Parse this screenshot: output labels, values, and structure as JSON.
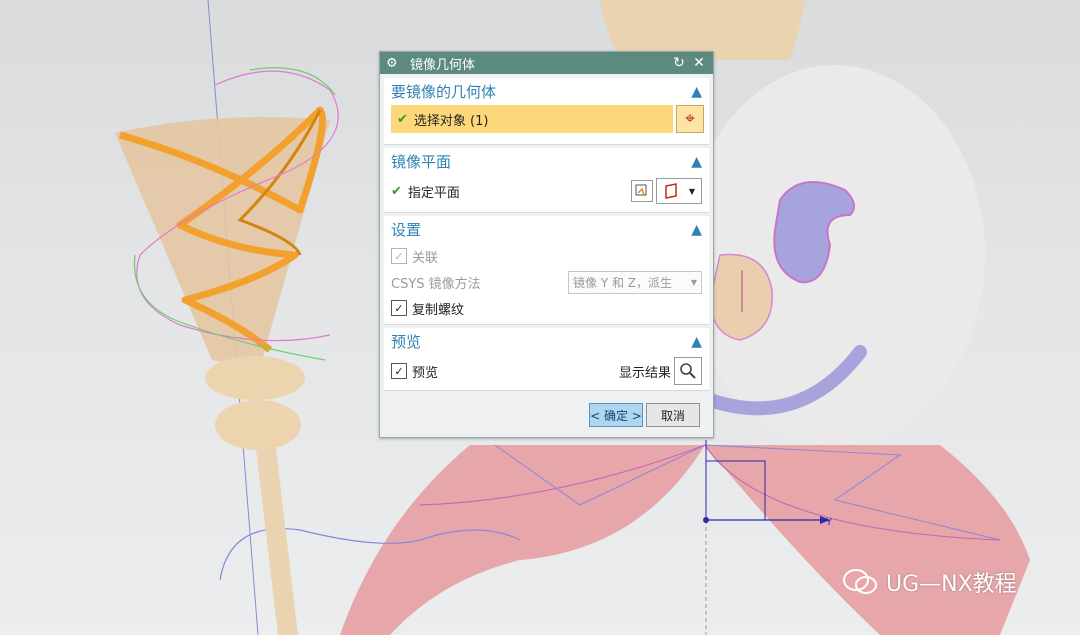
{
  "dialog": {
    "title": "镜像几何体",
    "icons": {
      "settings": "gear-icon",
      "reset": "reset-icon",
      "close": "close-icon"
    }
  },
  "groups": {
    "geometry": {
      "title": "要镜像的几何体",
      "select_label": "选择对象 (1)",
      "select_icon": "crosshair-icon"
    },
    "plane": {
      "title": "镜像平面",
      "specify_label": "指定平面"
    },
    "settings": {
      "title": "设置",
      "associative_label": "关联",
      "associative_checked": true,
      "associative_disabled": true,
      "csys_label": "CSYS 镜像方法",
      "csys_value": "镜像 Y 和 Z，派生",
      "copy_threads_label": "复制螺纹",
      "copy_threads_checked": true
    },
    "preview": {
      "title": "预览",
      "preview_label": "预览",
      "preview_checked": true,
      "show_result_label": "显示结果"
    }
  },
  "buttons": {
    "ok": "< 确定 >",
    "cancel": "取消"
  },
  "viewport": {
    "axis_label": "Y",
    "watermark": "UG—NX教程",
    "colors": {
      "accent": "#5c8a80",
      "highlight": "#fdd87a",
      "title_blue": "#2f82b5"
    }
  }
}
